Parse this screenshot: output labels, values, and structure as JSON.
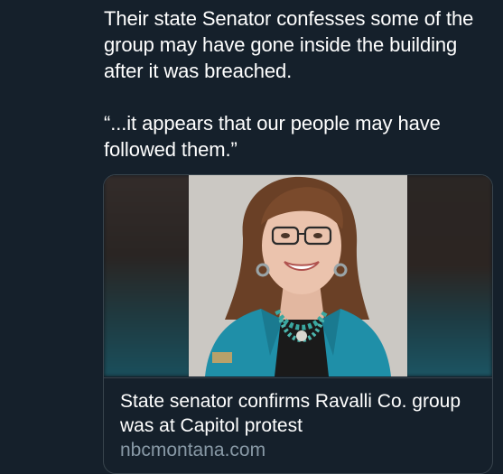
{
  "tweet": {
    "paragraph_1": "Their state Senator confesses some of the group may have gone inside the building after it was breached.",
    "paragraph_2": "“...it appears that our people may have followed them.”"
  },
  "card": {
    "image_alt": "Portrait of a woman in a teal blazer",
    "title": "State senator confirms Ravalli Co. group was at Capitol protest",
    "domain": "nbcmontana.com"
  },
  "colors": {
    "background": "#15202b",
    "text": "#ffffff",
    "secondary_text": "#8899a6",
    "border": "#38444d"
  }
}
